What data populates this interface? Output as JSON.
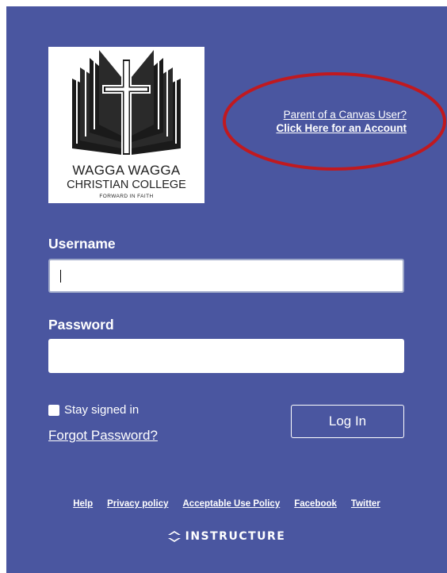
{
  "logo": {
    "line1": "WAGGA WAGGA",
    "line2": "CHRISTIAN COLLEGE",
    "line3": "FORWARD IN FAITH"
  },
  "parent_link": {
    "line1": "Parent of a Canvas User?",
    "line2": "Click Here for an Account"
  },
  "form": {
    "username_label": "Username",
    "username_value": "",
    "password_label": "Password",
    "password_value": "",
    "stay_signed_in_label": "Stay signed in",
    "stay_signed_in_checked": true,
    "forgot_password": "Forgot Password?",
    "login_button": "Log In"
  },
  "footer": {
    "links": [
      "Help",
      "Privacy policy",
      "Acceptable Use Policy",
      "Facebook",
      "Twitter"
    ]
  },
  "brand": {
    "name": "INSTRUCTURE",
    "icon": "instructure-logo-icon"
  },
  "colors": {
    "background": "#4a56a0",
    "annotation": "#c0191f",
    "text": "#ffffff"
  }
}
